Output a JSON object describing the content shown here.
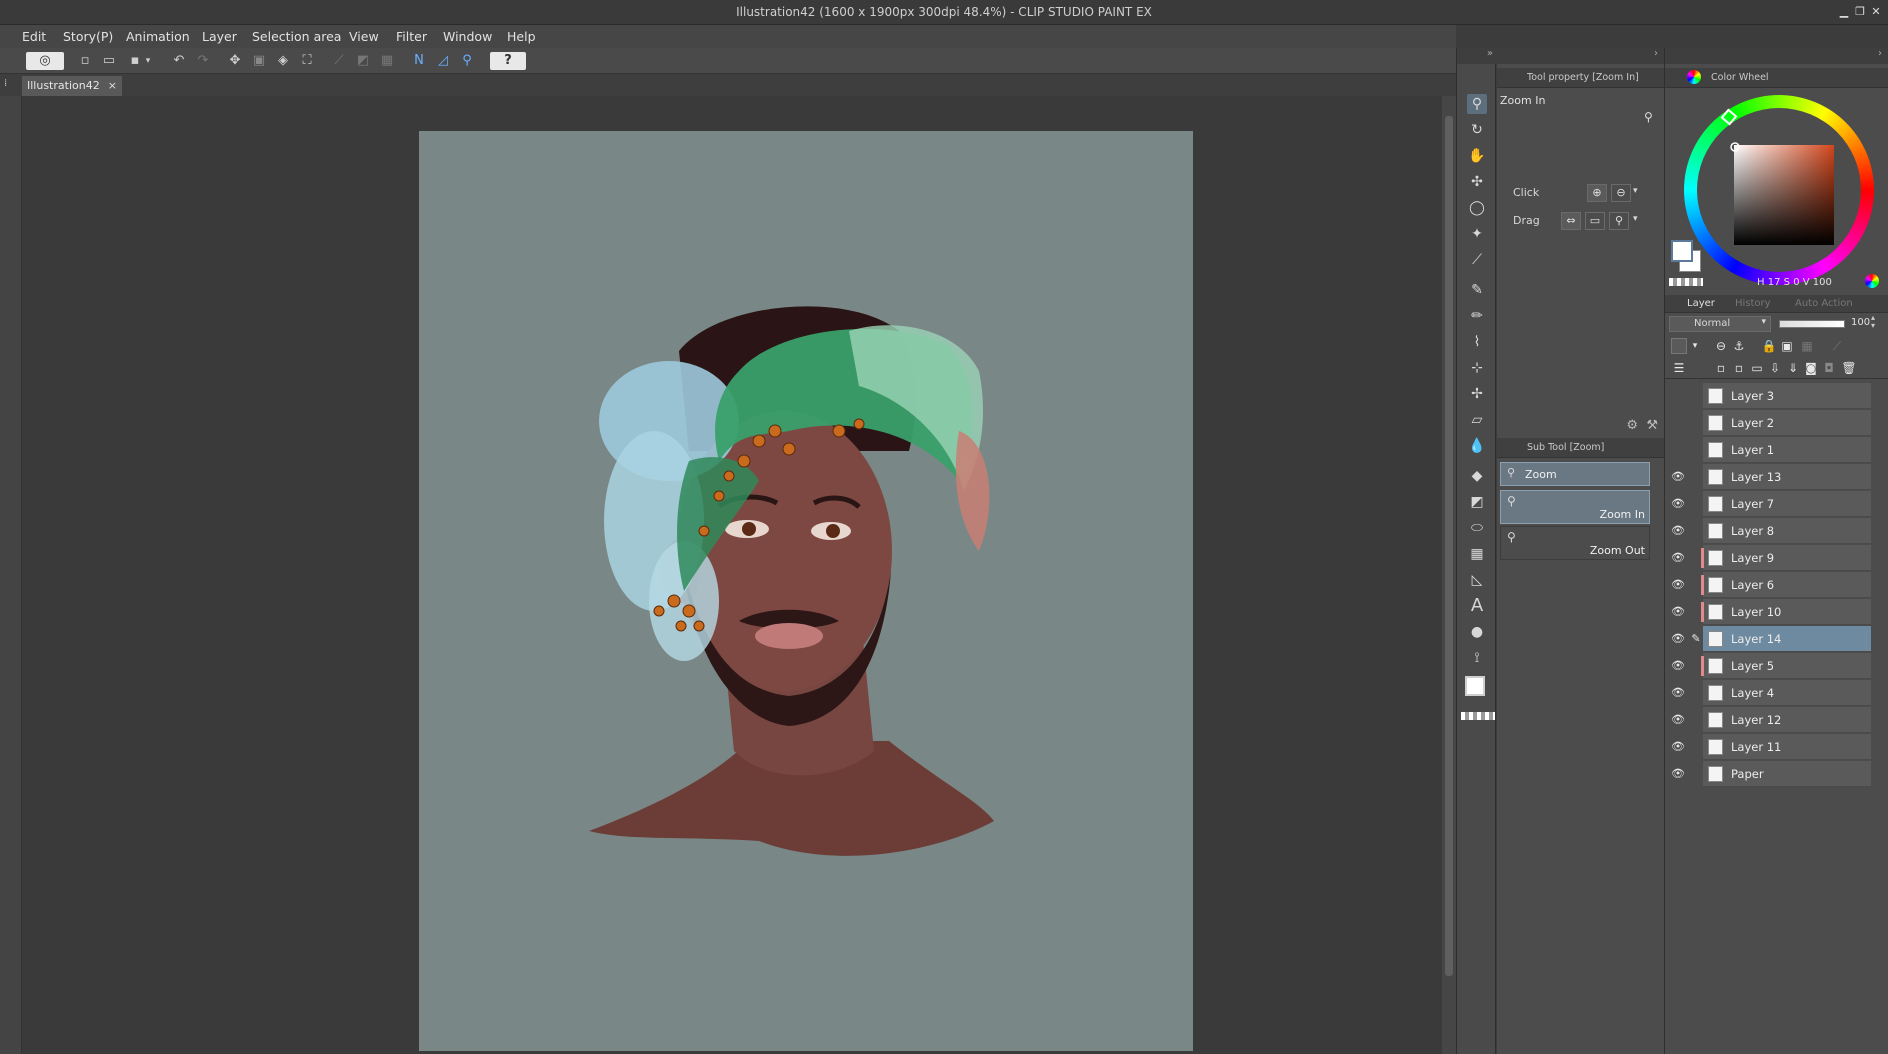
{
  "window": {
    "title": "Illustration42 (1600 x 1900px 300dpi 48.4%)  - CLIP STUDIO PAINT EX"
  },
  "menu": [
    "Edit",
    "Story(P)",
    "Animation",
    "Layer",
    "Selection area",
    "View",
    "Filter",
    "Window",
    "Help"
  ],
  "document": {
    "tab_label": "Illustration42",
    "close_glyph": "×"
  },
  "tool_property": {
    "header": "Tool property [Zoom In]",
    "tool_name": "Zoom In",
    "click_label": "Click",
    "drag_label": "Drag"
  },
  "sub_tool": {
    "header": "Sub Tool [Zoom]",
    "group": "Zoom",
    "items": [
      {
        "label": "Zoom In",
        "selected": true
      },
      {
        "label": "Zoom Out",
        "selected": false
      }
    ]
  },
  "color_wheel": {
    "header": "Color Wheel",
    "h_label": "H",
    "h_value": "17",
    "s_label": "S",
    "s_value": "0",
    "v_label": "V",
    "v_value": "100",
    "main_color": "#ffffff",
    "sub_color": "#ffffff",
    "hue_color": "#d2461c"
  },
  "layer_panel": {
    "tabs": [
      "Layer",
      "History",
      "Auto Action"
    ],
    "blend_mode": "Normal",
    "opacity": "100",
    "layers": [
      {
        "name": "Layer 3",
        "visible": false,
        "selected": false,
        "marked": false
      },
      {
        "name": "Layer 2",
        "visible": false,
        "selected": false,
        "marked": false
      },
      {
        "name": "Layer 1",
        "visible": false,
        "selected": false,
        "marked": false
      },
      {
        "name": "Layer 13",
        "visible": true,
        "selected": false,
        "marked": false
      },
      {
        "name": "Layer 7",
        "visible": true,
        "selected": false,
        "marked": false
      },
      {
        "name": "Layer 8",
        "visible": true,
        "selected": false,
        "marked": false
      },
      {
        "name": "Layer 9",
        "visible": true,
        "selected": false,
        "marked": true
      },
      {
        "name": "Layer 6",
        "visible": true,
        "selected": false,
        "marked": true
      },
      {
        "name": "Layer 10",
        "visible": true,
        "selected": false,
        "marked": true
      },
      {
        "name": "Layer 14",
        "visible": true,
        "selected": true,
        "marked": false
      },
      {
        "name": "Layer 5",
        "visible": true,
        "selected": false,
        "marked": true
      },
      {
        "name": "Layer 4",
        "visible": true,
        "selected": false,
        "marked": false
      },
      {
        "name": "Layer 12",
        "visible": true,
        "selected": false,
        "marked": false
      },
      {
        "name": "Layer 11",
        "visible": true,
        "selected": false,
        "marked": false
      },
      {
        "name": "Paper",
        "visible": true,
        "selected": false,
        "marked": false
      }
    ]
  },
  "colors": {
    "paper": "#7a8787",
    "selection": "#6d8aa0",
    "skin": "#7a4740",
    "beard": "#2c1716",
    "leaf_green": "#39a06a",
    "hair_blue": "#9cc9db",
    "berry": "#c96a1c"
  }
}
